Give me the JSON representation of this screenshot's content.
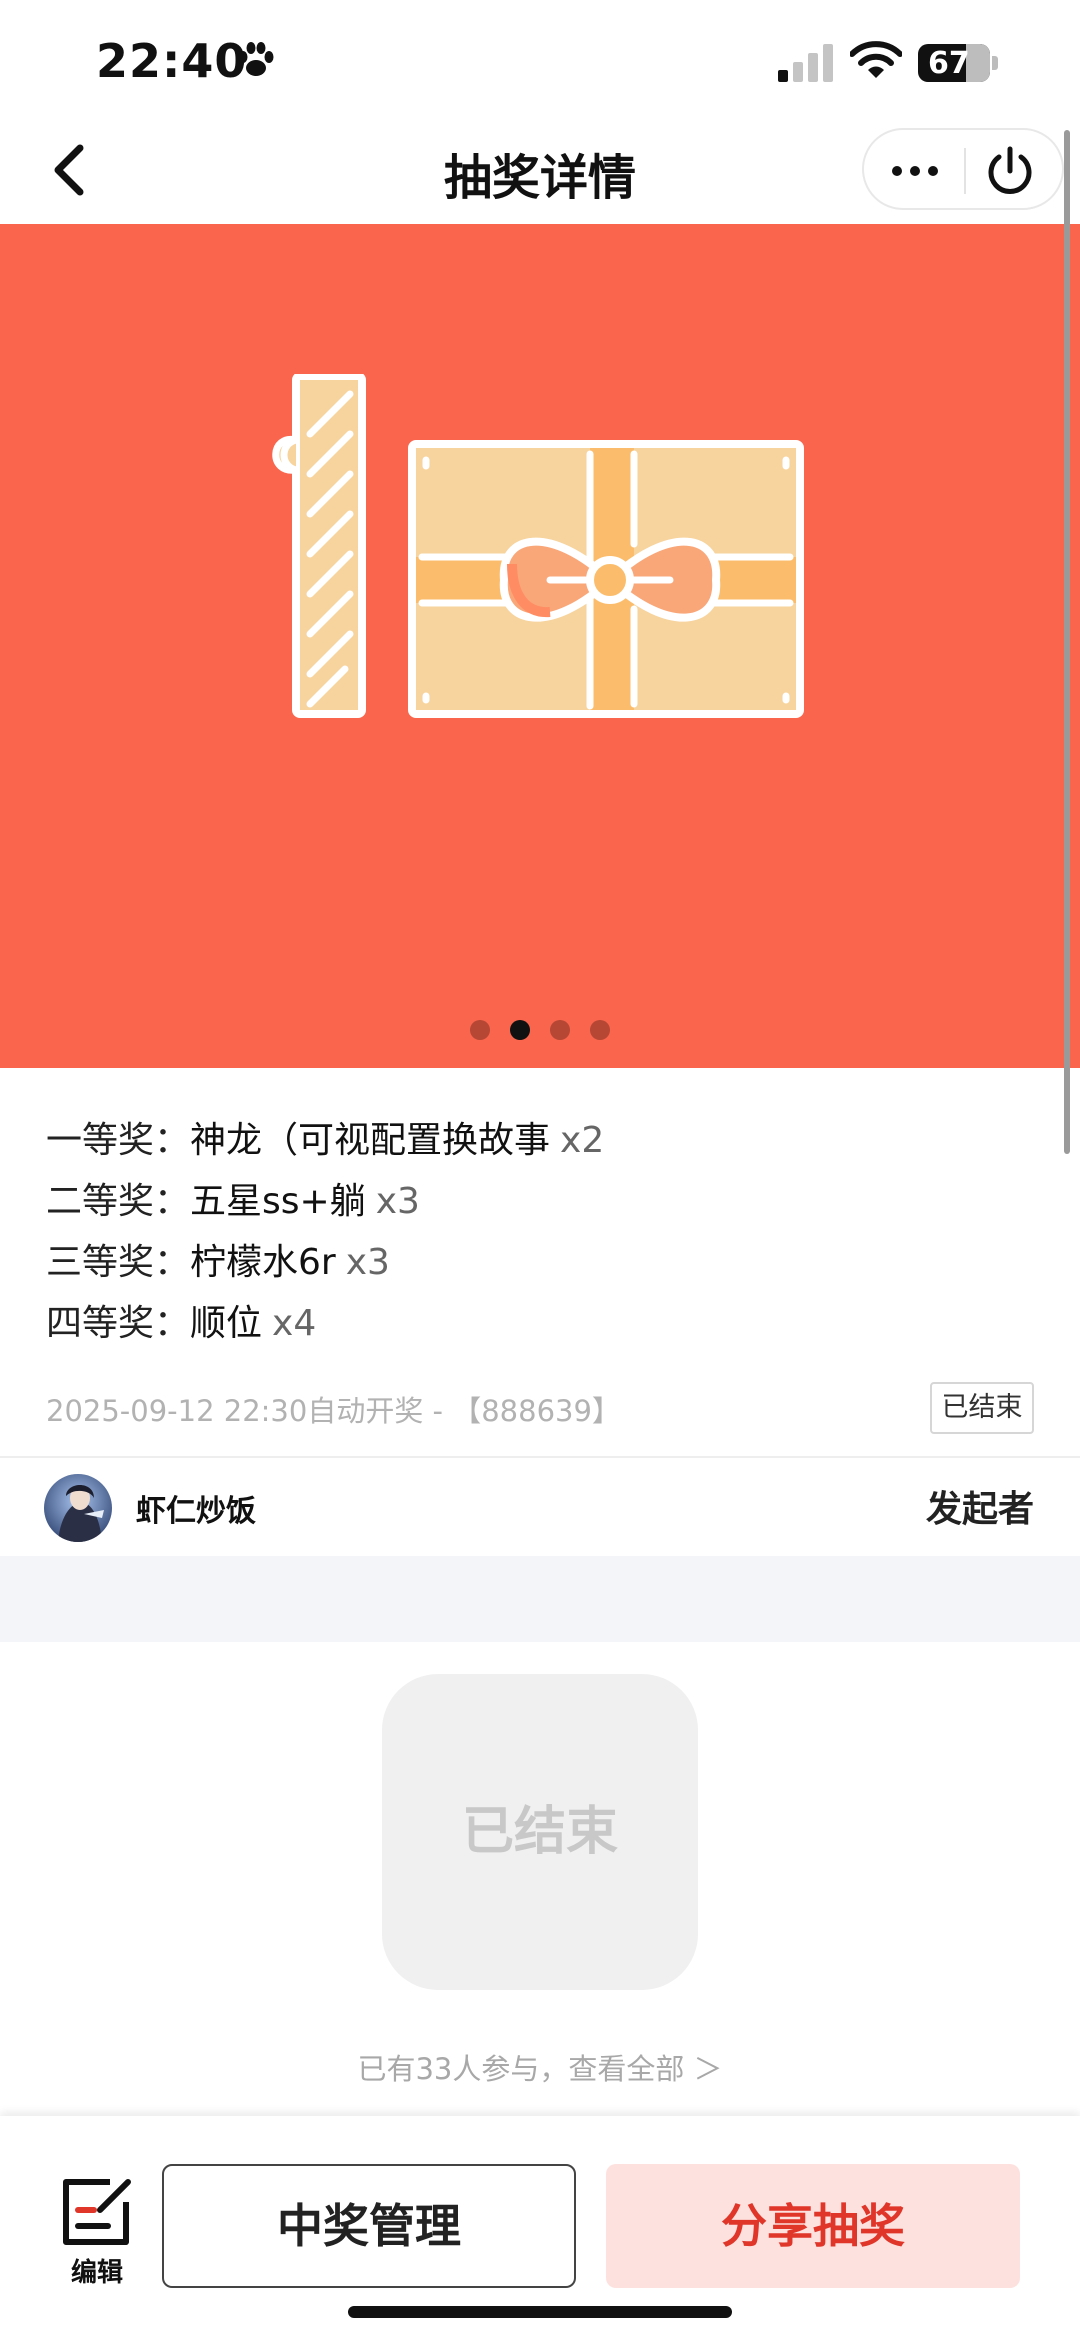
{
  "status_bar": {
    "time": "22:40",
    "battery": "67"
  },
  "nav": {
    "title": "抽奖详情"
  },
  "banner": {
    "background_color": "#f9664d",
    "slide_count": 4,
    "active_slide": 2
  },
  "prizes": [
    {
      "level": "一等奖：",
      "name": "神龙（可视配置换故事",
      "count": "x2"
    },
    {
      "level": "二等奖：",
      "name": "五星ss+躺",
      "count": "x3"
    },
    {
      "level": "三等奖：",
      "name": "柠檬水6r",
      "count": "x3"
    },
    {
      "level": "四等奖：",
      "name": "顺位",
      "count": "x4"
    }
  ],
  "draw_info": {
    "text": "2025-09-12 22:30自动开奖 - 【888639】",
    "status_tag": "已结束"
  },
  "initiator": {
    "name": "虾仁炒饭",
    "role": "发起者"
  },
  "result": {
    "status": "已结束",
    "participants_text": "已有33人参与，查看全部 ＞"
  },
  "bottom_bar": {
    "edit_label": "编辑",
    "manage_label": "中奖管理",
    "share_label": "分享抽奖",
    "accent_color": "#e0362a"
  }
}
